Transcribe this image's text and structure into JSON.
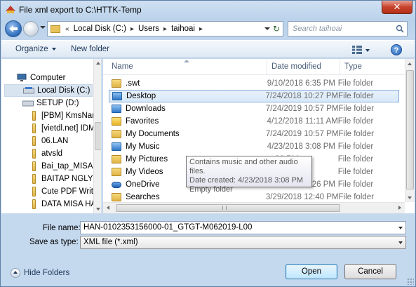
{
  "window": {
    "title": "File xml export to C:\\HTTK-Temp",
    "close_glyph": "✕"
  },
  "address": {
    "prefix": "«",
    "crumbs": [
      "Local Disk (C:)",
      "Users",
      "taihoai"
    ],
    "search_placeholder": "Search taihoai"
  },
  "toolbar": {
    "organize_label": "Organize",
    "new_folder_label": "New folder",
    "help_glyph": "?"
  },
  "sidebar": {
    "items": [
      {
        "label": "Computer",
        "icon": "computer-icon"
      },
      {
        "label": "Local Disk (C:)",
        "icon": "drive-icon"
      },
      {
        "label": "SETUP (D:)",
        "icon": "drive-icon"
      },
      {
        "label": "[PBM] KmsNar",
        "icon": "folder-icon"
      },
      {
        "label": "[vietdl.net] IDM",
        "icon": "folder-icon"
      },
      {
        "label": "06.LAN",
        "icon": "folder-icon"
      },
      {
        "label": "atvsld",
        "icon": "folder-icon"
      },
      {
        "label": "Bai_tap_MISA",
        "icon": "folder-icon"
      },
      {
        "label": "BAITAP NGLY D",
        "icon": "folder-icon"
      },
      {
        "label": "Cute PDF Write",
        "icon": "folder-icon"
      },
      {
        "label": "DATA MISA HA",
        "icon": "folder-icon"
      }
    ]
  },
  "file_list": {
    "columns": [
      "Name",
      "Date modified",
      "Type"
    ],
    "rows": [
      {
        "name": ".swt",
        "date": "9/10/2018 6:35 PM",
        "type": "File folder",
        "icon": "folder-icon"
      },
      {
        "name": "Desktop",
        "date": "7/24/2018 10:27 PM",
        "type": "File folder",
        "icon": "desktop-folder-icon"
      },
      {
        "name": "Downloads",
        "date": "7/24/2019 10:57 PM",
        "type": "File folder",
        "icon": "downloads-folder-icon"
      },
      {
        "name": "Favorites",
        "date": "4/12/2018 11:11 AM",
        "type": "File folder",
        "icon": "favorites-folder-icon"
      },
      {
        "name": "My Documents",
        "date": "7/24/2019 10:57 PM",
        "type": "File folder",
        "icon": "documents-folder-icon"
      },
      {
        "name": "My Music",
        "date": "4/23/2018 3:08 PM",
        "type": "File folder",
        "icon": "music-folder-icon"
      },
      {
        "name": "My Pictures",
        "date": "…33 PM",
        "type": "File folder",
        "icon": "pictures-folder-icon"
      },
      {
        "name": "My Videos",
        "date": "…57 PM",
        "type": "File folder",
        "icon": "videos-folder-icon"
      },
      {
        "name": "OneDrive",
        "date": "2/28/2019 3:26 PM",
        "type": "File folder",
        "icon": "onedrive-icon"
      },
      {
        "name": "Searches",
        "date": "3/29/2018 12:40 PM",
        "type": "File folder",
        "icon": "searches-folder-icon"
      }
    ],
    "selected_index": 1
  },
  "tooltip": {
    "line1": "Contains music and other audio files.",
    "line2": "Date created: 4/23/2018 3:08 PM",
    "line3": "Empty folder"
  },
  "form": {
    "file_name_label": "File name:",
    "file_name_value": "HAN-0102353156000-01_GTGT-M062019-L00",
    "save_as_label": "Save as type:",
    "save_as_value": "XML file (*.xml)"
  },
  "footer": {
    "hide_folders_label": "Hide Folders",
    "open_label": "Open",
    "cancel_label": "Cancel"
  }
}
